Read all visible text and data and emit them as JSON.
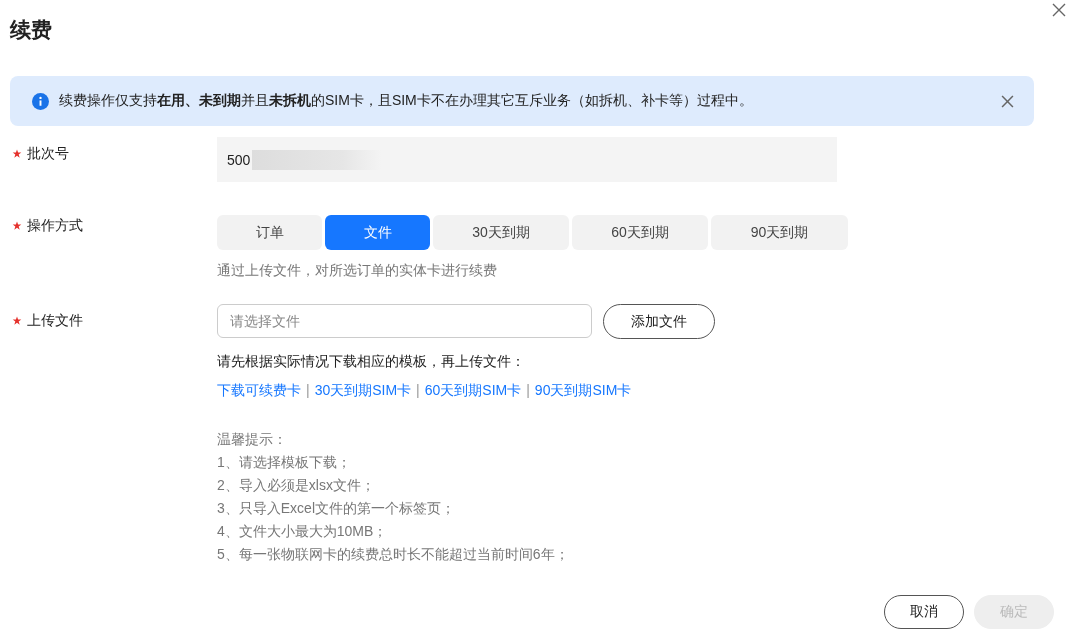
{
  "dialog": {
    "title": "续费"
  },
  "alert": {
    "text": "续费操作仅支持**在用、未到期**并且**未拆机**的SIM卡，且SIM卡不在办理其它互斥业务（如拆机、补卡等）过程中。"
  },
  "batch": {
    "label": "批次号",
    "required": true,
    "value": "500"
  },
  "mode": {
    "label": "操作方式",
    "required": true,
    "options": [
      {
        "label": "订单",
        "selected": false
      },
      {
        "label": "文件",
        "selected": true
      },
      {
        "label": "30天到期",
        "selected": false
      },
      {
        "label": "60天到期",
        "selected": false
      },
      {
        "label": "90天到期",
        "selected": false
      }
    ],
    "hint": "通过上传文件，对所选订单的实体卡进行续费"
  },
  "upload": {
    "label": "上传文件",
    "required": true,
    "placeholder": "请选择文件",
    "button": "添加文件",
    "instruction": "请先根据实际情况下载相应的模板，再上传文件：",
    "links": [
      "下载可续费卡",
      "30天到期SIM卡",
      "60天到期SIM卡",
      "90天到期SIM卡"
    ],
    "separator": "|",
    "tips_title": "温馨提示：",
    "tips": [
      "1、请选择模板下载；",
      "2、导入必须是xlsx文件；",
      "3、只导入Excel文件的第一个标签页；",
      "4、文件大小最大为10MB；",
      "5、每一张物联网卡的续费总时长不能超过当前时间6年；"
    ]
  },
  "buttons": [
    {
      "label": "取消",
      "disabled": false
    },
    {
      "label": "确定",
      "disabled": true
    }
  ]
}
